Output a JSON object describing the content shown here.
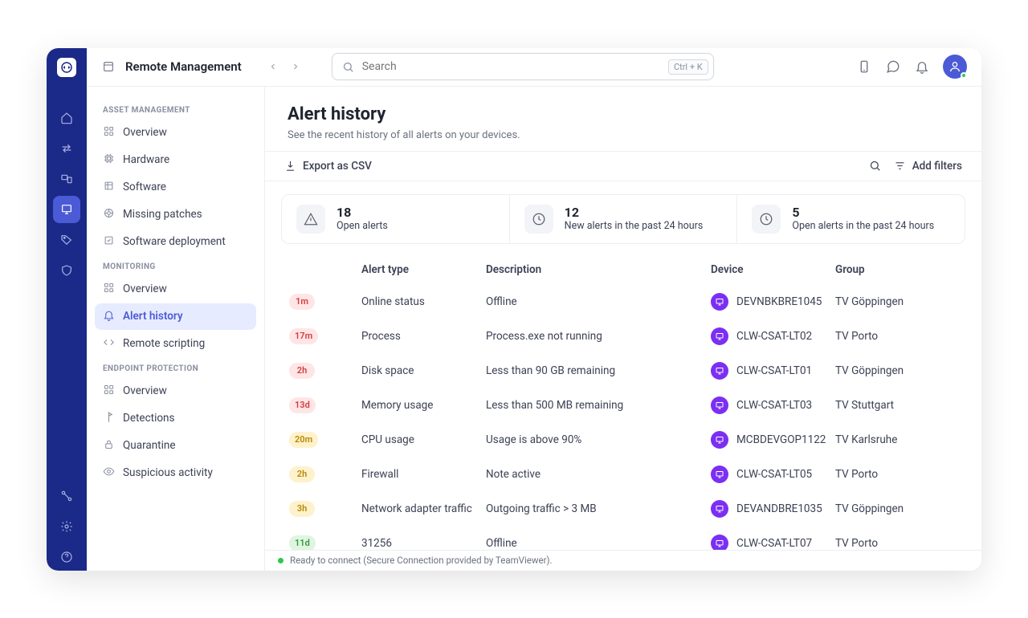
{
  "header": {
    "title": "Remote Management",
    "search_placeholder": "Search",
    "shortcut": "Ctrl + K"
  },
  "sidebar": {
    "sections": [
      {
        "title": "ASSET MANAGEMENT",
        "items": [
          {
            "label": "Overview",
            "icon": "grid"
          },
          {
            "label": "Hardware",
            "icon": "cpu"
          },
          {
            "label": "Software",
            "icon": "package"
          },
          {
            "label": "Missing patches",
            "icon": "patch"
          },
          {
            "label": "Software deployment",
            "icon": "deploy"
          }
        ]
      },
      {
        "title": "MONITORING",
        "items": [
          {
            "label": "Overview",
            "icon": "grid"
          },
          {
            "label": "Alert history",
            "icon": "bell",
            "active": true
          },
          {
            "label": "Remote scripting",
            "icon": "code"
          }
        ]
      },
      {
        "title": "ENDPOINT PROTECTION",
        "items": [
          {
            "label": "Overview",
            "icon": "grid"
          },
          {
            "label": "Detections",
            "icon": "flag"
          },
          {
            "label": "Quarantine",
            "icon": "lock"
          },
          {
            "label": "Suspicious activity",
            "icon": "eye"
          }
        ]
      }
    ]
  },
  "page": {
    "title": "Alert history",
    "subtitle": "See the recent history of all alerts on your devices.",
    "export_label": "Export as CSV",
    "add_filters_label": "Add filters"
  },
  "stats": [
    {
      "value": "18",
      "label": "Open alerts",
      "icon": "warn"
    },
    {
      "value": "12",
      "label": "New alerts in the past 24 hours",
      "icon": "clock"
    },
    {
      "value": "5",
      "label": "Open alerts in the past 24 hours",
      "icon": "clock"
    }
  ],
  "columns": {
    "c0": "",
    "c1": "Alert type",
    "c2": "Description",
    "c3": "Device",
    "c4": "Group"
  },
  "rows": [
    {
      "age": "1m",
      "ageClass": "b-red",
      "type": "Online status",
      "desc": "Offline",
      "device": "DEVNBKBRE1045",
      "group": "TV Göppingen"
    },
    {
      "age": "17m",
      "ageClass": "b-red",
      "type": "Process",
      "desc": "Process.exe not running",
      "device": "CLW-CSAT-LT02",
      "group": "TV Porto"
    },
    {
      "age": "2h",
      "ageClass": "b-red",
      "type": "Disk space",
      "desc": "Less than 90 GB remaining",
      "device": "CLW-CSAT-LT01",
      "group": "TV Göppingen"
    },
    {
      "age": "13d",
      "ageClass": "b-red",
      "type": "Memory usage",
      "desc": "Less than 500 MB remaining",
      "device": "CLW-CSAT-LT03",
      "group": "TV Stuttgart"
    },
    {
      "age": "20m",
      "ageClass": "b-yellow",
      "type": "CPU usage",
      "desc": "Usage is above 90%",
      "device": "MCBDEVGOP1122",
      "group": "TV Karlsruhe"
    },
    {
      "age": "2h",
      "ageClass": "b-yellow",
      "type": "Firewall",
      "desc": "Note active",
      "device": "CLW-CSAT-LT05",
      "group": "TV Porto"
    },
    {
      "age": "3h",
      "ageClass": "b-yellow",
      "type": "Network adapter traffic",
      "desc": "Outgoing traffic > 3 MB",
      "device": "DEVANDBRE1035",
      "group": "TV Göppingen"
    },
    {
      "age": "11d",
      "ageClass": "b-green",
      "type": "31256",
      "desc": "Offline",
      "device": "CLW-CSAT-LT07",
      "group": "TV Porto"
    }
  ],
  "status_text": "Ready to connect (Secure Connection provided by TeamViewer)."
}
